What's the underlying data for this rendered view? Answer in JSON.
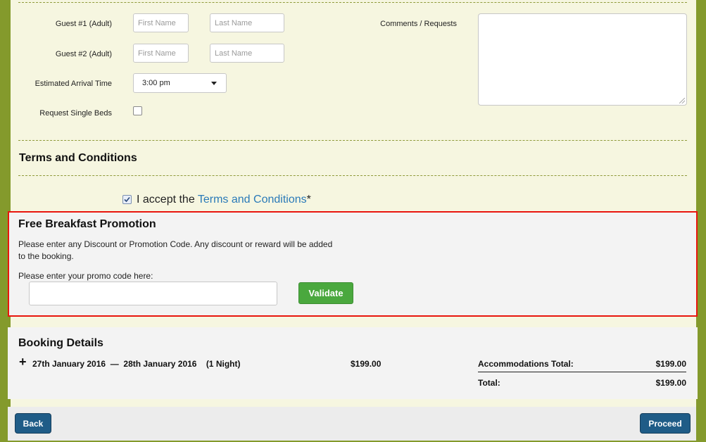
{
  "guests": [
    {
      "label": "Guest #1 (Adult)",
      "first_placeholder": "First Name",
      "last_placeholder": "Last Name"
    },
    {
      "label": "Guest #2 (Adult)",
      "first_placeholder": "First Name",
      "last_placeholder": "Last Name"
    }
  ],
  "arrival": {
    "label": "Estimated Arrival Time",
    "value": "3:00 pm"
  },
  "single_beds": {
    "label": "Request Single Beds",
    "checked": false
  },
  "comments": {
    "label": "Comments / Requests"
  },
  "terms": {
    "title": "Terms and Conditions",
    "accept_prefix": "I accept the",
    "accept_link": "Terms and Conditions",
    "required_mark": "*",
    "checked": true
  },
  "promo": {
    "title": "Free Breakfast Promotion",
    "description_line1": "Please enter any Discount or Promotion Code. Any discount or reward will be added",
    "description_line2": "to the booking.",
    "input_label": "Please enter your promo code here:",
    "validate_label": "Validate"
  },
  "booking": {
    "title": "Booking Details",
    "expand_symbol": "+",
    "check_in": "27th January 2016",
    "separator": "—",
    "check_out": "28th January 2016",
    "nights": "(1 Night)",
    "price": "$199.00",
    "accommodations_label": "Accommodations Total:",
    "accommodations_value": "$199.00",
    "total_label": "Total:",
    "total_value": "$199.00"
  },
  "footer": {
    "back_label": "Back",
    "proceed_label": "Proceed"
  },
  "colors": {
    "frame": "#849a2c",
    "cream": "#f6f6e0",
    "link": "#2a7ab8",
    "validate": "#4aa83e",
    "nav_button": "#1f5c87",
    "highlight_border": "#e8150d"
  }
}
